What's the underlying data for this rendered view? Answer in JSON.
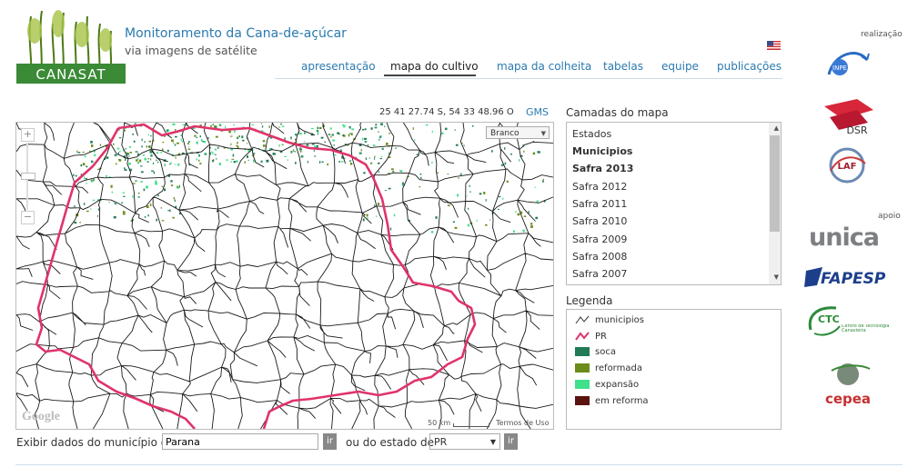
{
  "header": {
    "logo_text": "CANASAT",
    "title": "Monitoramento da Cana-de-açúcar",
    "subtitle": "via imagens de satélite"
  },
  "nav": {
    "items": [
      {
        "label": "apresentação",
        "active": false
      },
      {
        "label": "mapa do cultivo",
        "active": true
      },
      {
        "label": "mapa da colheita",
        "active": false
      },
      {
        "label": "tabelas",
        "active": false
      },
      {
        "label": "equipe",
        "active": false
      },
      {
        "label": "publicações",
        "active": false
      }
    ]
  },
  "map": {
    "coordinates": "25 41 27.74 S, 54 33 48.96 O",
    "coord_format": "GMS",
    "basemap": "Branco",
    "zoom_in": "+",
    "zoom_out": "−",
    "attribution": "Google",
    "scale_label": "50 km",
    "terms": "Termos de Uso"
  },
  "layers": {
    "title": "Camadas do mapa",
    "items": [
      {
        "label": "Estados",
        "selected": false
      },
      {
        "label": "Municipios",
        "selected": true
      },
      {
        "label": "Safra 2013",
        "selected": true
      },
      {
        "label": "Safra 2012",
        "selected": false
      },
      {
        "label": "Safra 2011",
        "selected": false
      },
      {
        "label": "Safra 2010",
        "selected": false
      },
      {
        "label": "Safra 2009",
        "selected": false
      },
      {
        "label": "Safra 2008",
        "selected": false
      },
      {
        "label": "Safra 2007",
        "selected": false
      }
    ]
  },
  "legend": {
    "title": "Legenda",
    "items": [
      {
        "label": "municipios",
        "kind": "line",
        "color": "#333333"
      },
      {
        "label": "PR",
        "kind": "line",
        "color": "#e0336a"
      },
      {
        "label": "soca",
        "kind": "swatch",
        "color": "#1f7a55"
      },
      {
        "label": "reformada",
        "kind": "swatch",
        "color": "#6b8c1a"
      },
      {
        "label": "expansão",
        "kind": "swatch",
        "color": "#3fe08a"
      },
      {
        "label": "em reforma",
        "kind": "swatch",
        "color": "#5a1410"
      }
    ]
  },
  "form": {
    "municipio_label": "Exibir dados do município de",
    "municipio_value": "Parana",
    "go_label": "ir",
    "estado_label": "ou do estado de",
    "estado_value": "PR"
  },
  "sidebar": {
    "realizacao_label": "realização",
    "apoio_label": "apoio",
    "sponsors": [
      "INPE",
      "DSR",
      "LAF",
      "unica",
      "FAPESP",
      "CTC",
      "Centro de Tecnologia Canavieira",
      "cepea"
    ]
  },
  "colors": {
    "link": "#2a7ab0",
    "state_border": "#e0336a",
    "municipality_border": "#1a1a1a"
  }
}
